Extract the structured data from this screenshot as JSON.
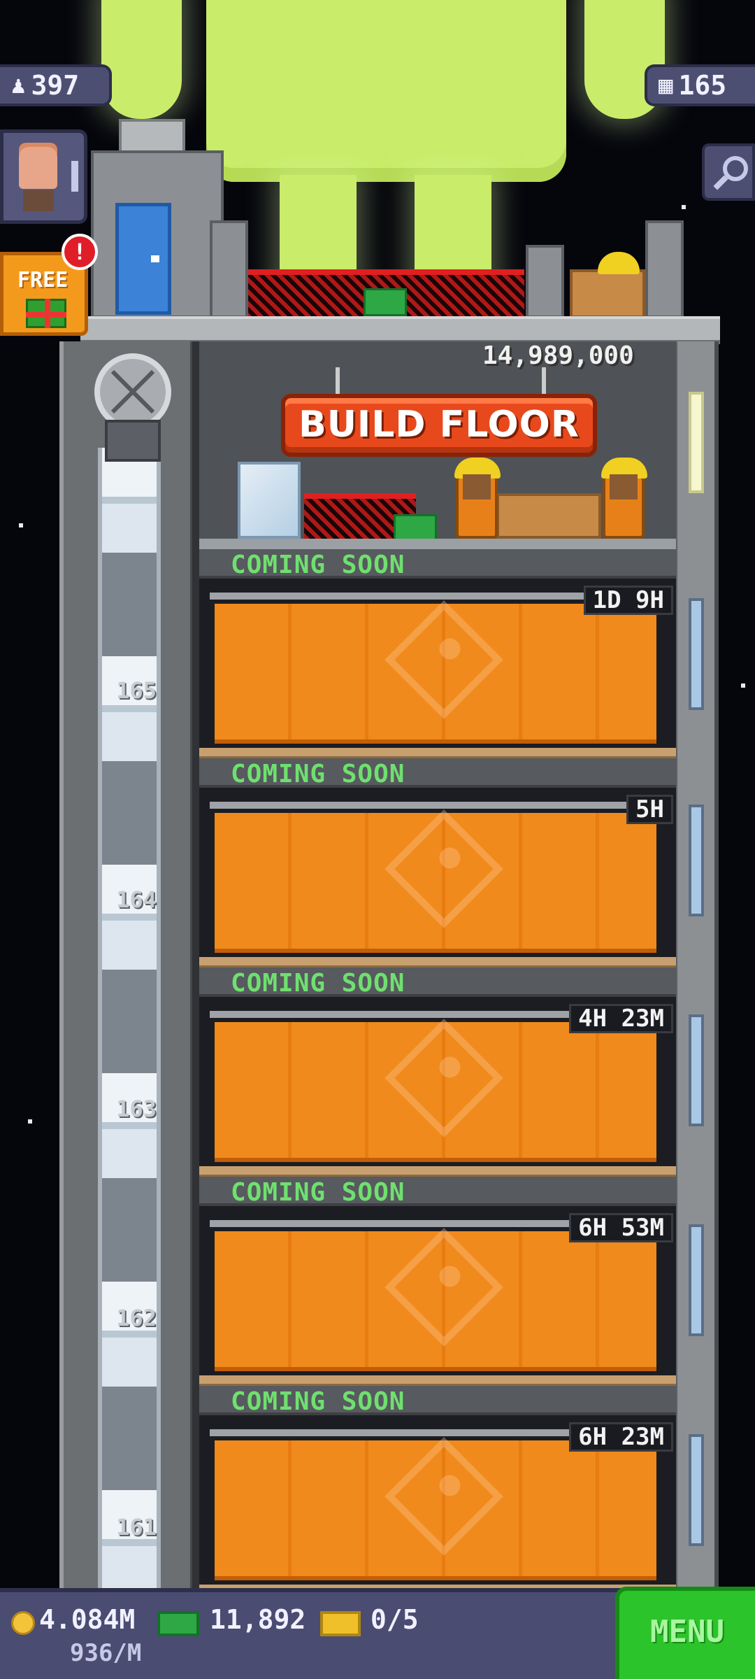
{
  "hud": {
    "population": "397",
    "population_icon": "person-icon",
    "floors": "165",
    "floors_icon": "building-icon",
    "free_label": "FREE",
    "alert_mark": "!"
  },
  "build": {
    "cost": "14,989,000",
    "button_label": "BUILD FLOOR"
  },
  "floors": [
    {
      "number": "165",
      "status": "COMING SOON",
      "timer": "1D 9H"
    },
    {
      "number": "164",
      "status": "COMING SOON",
      "timer": "5H"
    },
    {
      "number": "163",
      "status": "COMING SOON",
      "timer": "4H 23M"
    },
    {
      "number": "162",
      "status": "COMING SOON",
      "timer": "6H 53M"
    },
    {
      "number": "161",
      "status": "COMING SOON",
      "timer": "6H 23M"
    }
  ],
  "bottom": {
    "coins": "4.084M",
    "coin_rate": "936/M",
    "bux": "11,892",
    "tickets": "0/5",
    "menu_label": "MENU"
  },
  "colors": {
    "curtain": "#f08a1c",
    "coming_soon_text": "#6fe06f",
    "build_button": "#e8491c",
    "menu_button": "#2bc42b"
  }
}
